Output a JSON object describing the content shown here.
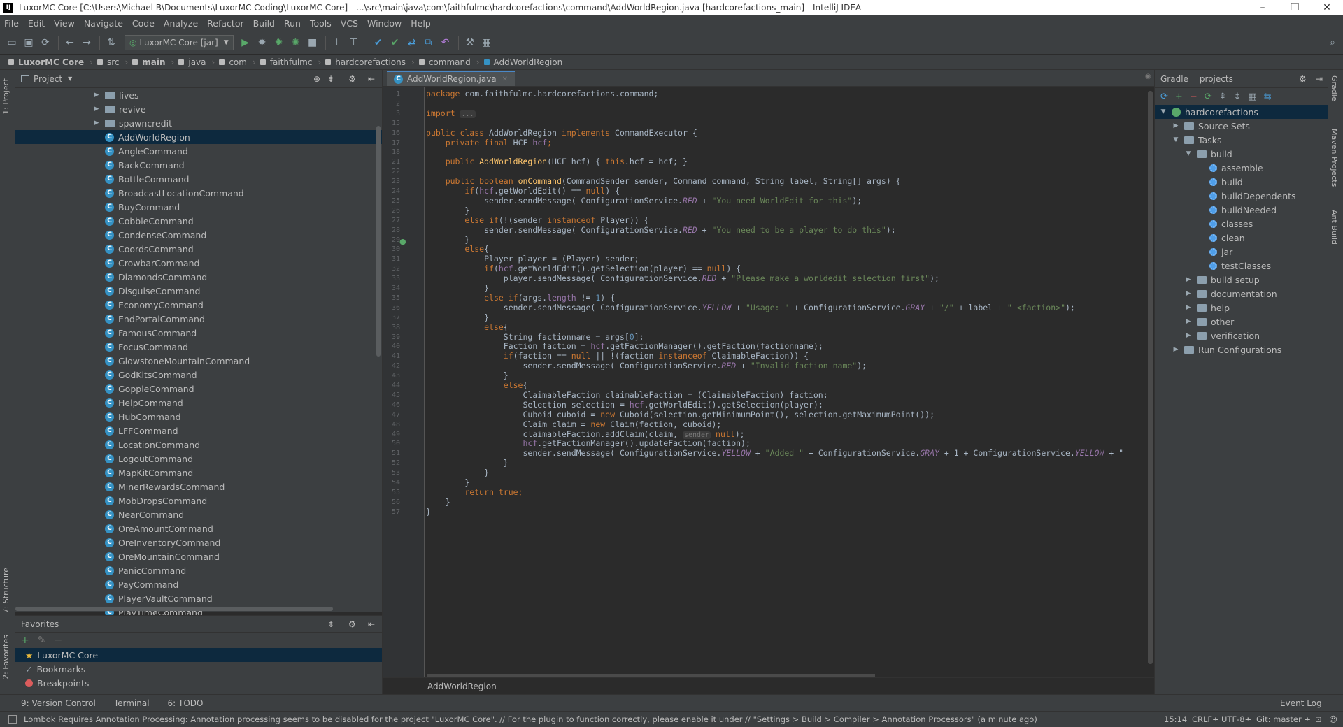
{
  "window": {
    "title": "LuxorMC Core [C:\\Users\\Michael B\\Documents\\LuxorMC Coding\\LuxorMC Core] - ...\\src\\main\\java\\com\\faithfulmc\\hardcorefactions\\command\\AddWorldRegion.java [hardcorefactions_main] - IntelliJ IDEA"
  },
  "menu": [
    "File",
    "Edit",
    "View",
    "Navigate",
    "Code",
    "Analyze",
    "Refactor",
    "Build",
    "Run",
    "Tools",
    "VCS",
    "Window",
    "Help"
  ],
  "toolbar": {
    "run_config": "LuxorMC Core [jar]"
  },
  "breadcrumbs": [
    "LuxorMC Core",
    "src",
    "main",
    "java",
    "com",
    "faithfulmc",
    "hardcorefactions",
    "command",
    "AddWorldRegion"
  ],
  "project_panel": {
    "title": "Project",
    "folders": [
      "lives",
      "revive",
      "spawncredit"
    ],
    "classes": [
      "AddWorldRegion",
      "AngleCommand",
      "BackCommand",
      "BottleCommand",
      "BroadcastLocationCommand",
      "BuyCommand",
      "CobbleCommand",
      "CondenseCommand",
      "CoordsCommand",
      "CrowbarCommand",
      "DiamondsCommand",
      "DisguiseCommand",
      "EconomyCommand",
      "EndPortalCommand",
      "FamousCommand",
      "FocusCommand",
      "GlowstoneMountainCommand",
      "GodKitsCommand",
      "GoppleCommand",
      "HelpCommand",
      "HubCommand",
      "LFFCommand",
      "LocationCommand",
      "LogoutCommand",
      "MapKitCommand",
      "MinerRewardsCommand",
      "MobDropsCommand",
      "NearCommand",
      "OreAmountCommand",
      "OreInventoryCommand",
      "OreMountainCommand",
      "PanicCommand",
      "PayCommand",
      "PlayerVaultCommand",
      "PlayTimeCommand"
    ],
    "selected": "AddWorldRegion"
  },
  "favorites": {
    "title": "Favorites",
    "items": [
      "LuxorMC Core",
      "Bookmarks",
      "Breakpoints"
    ]
  },
  "left_strip": {
    "project": "1: Project",
    "structure": "7: Structure",
    "favorites": "2: Favorites"
  },
  "editor": {
    "tab": "AddWorldRegion.java",
    "breadcrumb": "AddWorldRegion",
    "line_numbers": [
      "1",
      "2",
      "3",
      "15",
      "16",
      "17",
      "18",
      "21",
      "22",
      "23",
      "24",
      "25",
      "26",
      "27",
      "28",
      "29",
      "30",
      "31",
      "32",
      "33",
      "34",
      "35",
      "36",
      "37",
      "38",
      "39",
      "40",
      "41",
      "42",
      "43",
      "44",
      "45",
      "46",
      "47",
      "48",
      "49",
      "50",
      "51",
      "52",
      "53",
      "54",
      "55",
      "56",
      "57"
    ],
    "lines": [
      {
        "t": [
          [
            "kw",
            "package "
          ],
          [
            "",
            "com.faithfulmc.hardcorefactions.command;"
          ]
        ]
      },
      {
        "t": []
      },
      {
        "t": [
          [
            "kw",
            "import "
          ],
          [
            "hint",
            "..."
          ]
        ]
      },
      {
        "t": []
      },
      {
        "t": [
          [
            "kw",
            "public class "
          ],
          [
            "",
            "AddWorldRegion "
          ],
          [
            "kw",
            "implements "
          ],
          [
            "",
            "CommandExecutor {"
          ]
        ]
      },
      {
        "t": [
          [
            "",
            "    "
          ],
          [
            "kw",
            "private final "
          ],
          [
            "",
            "HCF "
          ],
          [
            "fld",
            "hcf"
          ],
          [
            "kw",
            ";"
          ]
        ]
      },
      {
        "t": []
      },
      {
        "t": [
          [
            "",
            "    "
          ],
          [
            "kw",
            "public "
          ],
          [
            "fn",
            "AddWorldRegion"
          ],
          [
            "",
            "(HCF hcf) { "
          ],
          [
            "kw",
            "this"
          ],
          [
            "",
            ".hcf = hcf; }"
          ]
        ]
      },
      {
        "t": []
      },
      {
        "t": [
          [
            "",
            "    "
          ],
          [
            "kw",
            "public boolean "
          ],
          [
            "fn",
            "onCommand"
          ],
          [
            "",
            "(CommandSender sender, Command command, String label, String[] args) {"
          ]
        ]
      },
      {
        "t": [
          [
            "",
            "        "
          ],
          [
            "kw",
            "if"
          ],
          [
            "",
            "("
          ],
          [
            "fld",
            "hcf"
          ],
          [
            "",
            ".getWorldEdit() == "
          ],
          [
            "kw",
            "null"
          ],
          [
            "",
            ") {"
          ]
        ]
      },
      {
        "t": [
          [
            "",
            "            sender.sendMessage( ConfigurationService."
          ],
          [
            "fld ital",
            "RED"
          ],
          [
            "",
            " + "
          ],
          [
            "str",
            "\"You need WorldEdit for this\""
          ],
          [
            "",
            ");"
          ]
        ]
      },
      {
        "t": [
          [
            "",
            "        }"
          ]
        ]
      },
      {
        "t": [
          [
            "",
            "        "
          ],
          [
            "kw",
            "else if"
          ],
          [
            "",
            "(!(sender "
          ],
          [
            "kw",
            "instanceof "
          ],
          [
            "",
            "Player)) {"
          ]
        ]
      },
      {
        "t": [
          [
            "",
            "            sender.sendMessage( ConfigurationService."
          ],
          [
            "fld ital",
            "RED"
          ],
          [
            "",
            " + "
          ],
          [
            "str",
            "\"You need to be a player to do this\""
          ],
          [
            "",
            ");"
          ]
        ]
      },
      {
        "t": [
          [
            "",
            "        }"
          ]
        ]
      },
      {
        "t": [
          [
            "",
            "        "
          ],
          [
            "kw",
            "else"
          ],
          [
            "",
            "{"
          ]
        ]
      },
      {
        "t": [
          [
            "",
            "            Player player = (Player) sender;"
          ]
        ]
      },
      {
        "t": [
          [
            "",
            "            "
          ],
          [
            "kw",
            "if"
          ],
          [
            "",
            "("
          ],
          [
            "fld",
            "hcf"
          ],
          [
            "",
            ".getWorldEdit().getSelection(player) == "
          ],
          [
            "kw",
            "null"
          ],
          [
            "",
            ") {"
          ]
        ]
      },
      {
        "t": [
          [
            "",
            "                player.sendMessage( ConfigurationService."
          ],
          [
            "fld ital",
            "RED"
          ],
          [
            "",
            " + "
          ],
          [
            "str",
            "\"Please make a worldedit selection first\""
          ],
          [
            "",
            ");"
          ]
        ]
      },
      {
        "t": [
          [
            "",
            "            }"
          ]
        ]
      },
      {
        "t": [
          [
            "",
            "            "
          ],
          [
            "kw",
            "else if"
          ],
          [
            "",
            "(args."
          ],
          [
            "fld",
            "length"
          ],
          [
            "",
            " != "
          ],
          [
            "num",
            "1"
          ],
          [
            "",
            ") {"
          ]
        ]
      },
      {
        "t": [
          [
            "",
            "                sender.sendMessage( ConfigurationService."
          ],
          [
            "fld ital",
            "YELLOW"
          ],
          [
            "",
            " + "
          ],
          [
            "str",
            "\"Usage: \""
          ],
          [
            "",
            " + ConfigurationService."
          ],
          [
            "fld ital",
            "GRAY"
          ],
          [
            "",
            " + "
          ],
          [
            "str",
            "\"/\""
          ],
          [
            "",
            " + label + "
          ],
          [
            "str",
            "\" <faction>\""
          ],
          [
            "",
            ");"
          ]
        ]
      },
      {
        "t": [
          [
            "",
            "            }"
          ]
        ]
      },
      {
        "t": [
          [
            "",
            "            "
          ],
          [
            "kw",
            "else"
          ],
          [
            "",
            "{"
          ]
        ]
      },
      {
        "t": [
          [
            "",
            "                String factionname = args["
          ],
          [
            "num",
            "0"
          ],
          [
            "",
            "];"
          ]
        ]
      },
      {
        "t": [
          [
            "",
            "                Faction faction = "
          ],
          [
            "fld",
            "hcf"
          ],
          [
            "",
            ".getFactionManager().getFaction(factionname);"
          ]
        ]
      },
      {
        "t": [
          [
            "",
            "                "
          ],
          [
            "kw",
            "if"
          ],
          [
            "",
            "(faction == "
          ],
          [
            "kw",
            "null"
          ],
          [
            "",
            " || !(faction "
          ],
          [
            "kw",
            "instanceof "
          ],
          [
            "",
            "ClaimableFaction)) {"
          ]
        ]
      },
      {
        "t": [
          [
            "",
            "                    sender.sendMessage( ConfigurationService."
          ],
          [
            "fld ital",
            "RED"
          ],
          [
            "",
            " + "
          ],
          [
            "str",
            "\"Invalid faction name\""
          ],
          [
            "",
            ");"
          ]
        ]
      },
      {
        "t": [
          [
            "",
            "                }"
          ]
        ]
      },
      {
        "t": [
          [
            "",
            "                "
          ],
          [
            "kw",
            "else"
          ],
          [
            "",
            "{"
          ]
        ]
      },
      {
        "t": [
          [
            "",
            "                    ClaimableFaction claimableFaction = (ClaimableFaction) faction;"
          ]
        ]
      },
      {
        "t": [
          [
            "",
            "                    Selection selection = "
          ],
          [
            "fld",
            "hcf"
          ],
          [
            "",
            ".getWorldEdit().getSelection(player);"
          ]
        ]
      },
      {
        "t": [
          [
            "",
            "                    Cuboid cuboid = "
          ],
          [
            "kw",
            "new "
          ],
          [
            "",
            "Cuboid(selection.getMinimumPoint(), selection.getMaximumPoint());"
          ]
        ]
      },
      {
        "t": [
          [
            "",
            "                    Claim claim = "
          ],
          [
            "kw",
            "new "
          ],
          [
            "",
            "Claim(faction, cuboid);"
          ]
        ]
      },
      {
        "t": [
          [
            "",
            "                    claimableFaction.addClaim(claim, "
          ],
          [
            "hint",
            "sender"
          ],
          [
            "",
            " "
          ],
          [
            "kw",
            "null"
          ],
          [
            "",
            ");"
          ]
        ]
      },
      {
        "t": [
          [
            "",
            "                    "
          ],
          [
            "fld",
            "hcf"
          ],
          [
            "",
            ".getFactionManager().updateFaction(faction);"
          ]
        ]
      },
      {
        "t": [
          [
            "",
            "                    sender.sendMessage( ConfigurationService."
          ],
          [
            "fld ital",
            "YELLOW"
          ],
          [
            "",
            " + "
          ],
          [
            "str",
            "\"Added \""
          ],
          [
            "",
            " + ConfigurationService."
          ],
          [
            "fld ital",
            "GRAY"
          ],
          [
            "",
            " + 1 + ConfigurationService."
          ],
          [
            "fld ital",
            "YELLOW"
          ],
          [
            "",
            " + \""
          ]
        ]
      },
      {
        "t": [
          [
            "",
            "                }"
          ]
        ]
      },
      {
        "t": [
          [
            "",
            "            }"
          ]
        ]
      },
      {
        "t": [
          [
            "",
            "        }"
          ]
        ]
      },
      {
        "t": [
          [
            "",
            "        "
          ],
          [
            "kw",
            "return true;"
          ]
        ]
      },
      {
        "t": [
          [
            "",
            "    }"
          ]
        ]
      },
      {
        "t": [
          [
            "",
            "}"
          ]
        ]
      }
    ]
  },
  "gradle": {
    "tabs": [
      "Gradle",
      "projects"
    ],
    "root": "hardcorefactions",
    "items": [
      {
        "label": "Source Sets",
        "depth": 1,
        "arrow": "▶",
        "type": "folder"
      },
      {
        "label": "Tasks",
        "depth": 1,
        "arrow": "▼",
        "type": "folder"
      },
      {
        "label": "build",
        "depth": 2,
        "arrow": "▼",
        "type": "folder"
      },
      {
        "label": "assemble",
        "depth": 3,
        "arrow": "",
        "type": "task"
      },
      {
        "label": "build",
        "depth": 3,
        "arrow": "",
        "type": "task"
      },
      {
        "label": "buildDependents",
        "depth": 3,
        "arrow": "",
        "type": "task"
      },
      {
        "label": "buildNeeded",
        "depth": 3,
        "arrow": "",
        "type": "task"
      },
      {
        "label": "classes",
        "depth": 3,
        "arrow": "",
        "type": "task"
      },
      {
        "label": "clean",
        "depth": 3,
        "arrow": "",
        "type": "task"
      },
      {
        "label": "jar",
        "depth": 3,
        "arrow": "",
        "type": "task"
      },
      {
        "label": "testClasses",
        "depth": 3,
        "arrow": "",
        "type": "task"
      },
      {
        "label": "build setup",
        "depth": 2,
        "arrow": "▶",
        "type": "folder"
      },
      {
        "label": "documentation",
        "depth": 2,
        "arrow": "▶",
        "type": "folder"
      },
      {
        "label": "help",
        "depth": 2,
        "arrow": "▶",
        "type": "folder"
      },
      {
        "label": "other",
        "depth": 2,
        "arrow": "▶",
        "type": "folder"
      },
      {
        "label": "verification",
        "depth": 2,
        "arrow": "▶",
        "type": "folder"
      },
      {
        "label": "Run Configurations",
        "depth": 1,
        "arrow": "▶",
        "type": "folder"
      }
    ]
  },
  "right_strip": {
    "gradle": "Gradle",
    "maven": "Maven Projects",
    "ant": "Ant Build"
  },
  "bottom_tabs": [
    "9: Version Control",
    "Terminal",
    "6: TODO"
  ],
  "event_log": "Event Log",
  "status": {
    "message": "Lombok Requires Annotation Processing: Annotation processing seems to be disabled for the project \"LuxorMC Core\". // For the plugin to function correctly, please enable it under // \"Settings > Build > Compiler > Annotation Processors\" (a minute ago)",
    "position": "15:14",
    "line_sep": "CRLF÷",
    "encoding": "UTF-8÷",
    "git": "Git: master ÷"
  },
  "colors": {
    "bg": "#2b2b2b",
    "panel": "#3c3f41",
    "selection": "#0d293e",
    "keyword": "#cc7832",
    "string": "#6a8759",
    "field": "#9876aa",
    "method": "#ffc66d"
  }
}
